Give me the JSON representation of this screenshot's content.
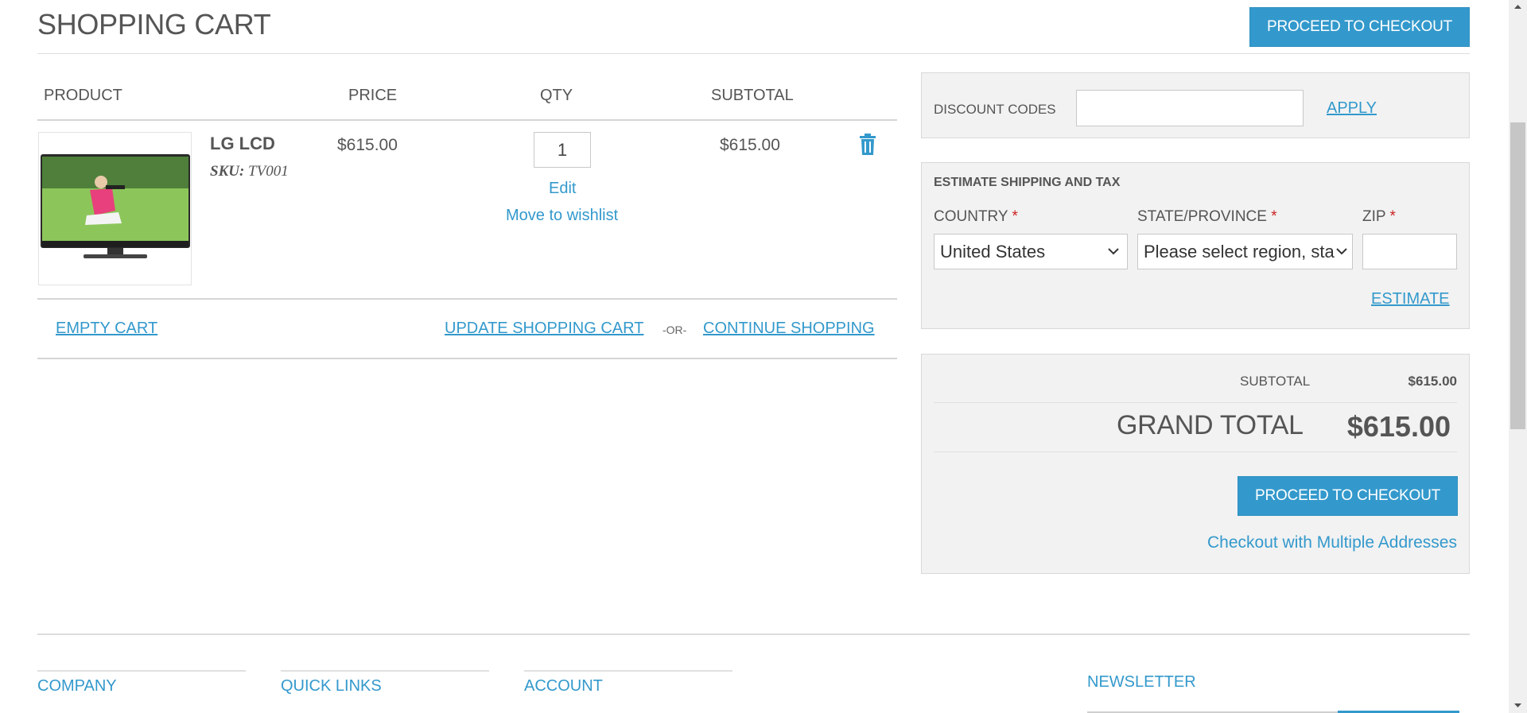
{
  "page": {
    "title": "SHOPPING CART"
  },
  "top": {
    "checkout_label": "PROCEED TO CHECKOUT"
  },
  "table": {
    "headers": {
      "product": "PRODUCT",
      "price": "PRICE",
      "qty": "QTY",
      "subtotal": "SUBTOTAL"
    },
    "item": {
      "name": "LG LCD",
      "sku_label": "SKU:",
      "sku_value": "TV001",
      "price": "$615.00",
      "qty": "1",
      "subtotal": "$615.00",
      "edit_label": "Edit",
      "wishlist_label": "Move to wishlist"
    }
  },
  "actions": {
    "empty_label": "EMPTY CART",
    "update_label": "UPDATE SHOPPING CART",
    "or_label": "-OR-",
    "continue_label": "CONTINUE SHOPPING"
  },
  "discount": {
    "label": "DISCOUNT CODES",
    "value": "",
    "apply_label": "APPLY"
  },
  "shipping": {
    "title": "ESTIMATE SHIPPING AND TAX",
    "country_label": "COUNTRY",
    "state_label": "STATE/PROVINCE",
    "zip_label": "ZIP",
    "required_mark": "*",
    "country_value": "United States",
    "state_value": "Please select region, state or province",
    "zip_value": "",
    "estimate_label": "ESTIMATE"
  },
  "totals": {
    "subtotal_label": "SUBTOTAL",
    "subtotal_value": "$615.00",
    "grand_label": "GRAND TOTAL",
    "grand_value": "$615.00",
    "checkout_label": "PROCEED TO CHECKOUT",
    "multi_label": "Checkout with Multiple Addresses"
  },
  "footer": {
    "company": "COMPANY",
    "quick_links": "QUICK LINKS",
    "account": "ACCOUNT",
    "newsletter": "NEWSLETTER"
  },
  "colors": {
    "accent": "#3399cc",
    "panel": "#f2f2f2",
    "required": "#cc2222"
  },
  "icons": [
    "trash-icon",
    "chevron-down-icon",
    "scroll-up-icon",
    "scroll-down-icon"
  ]
}
